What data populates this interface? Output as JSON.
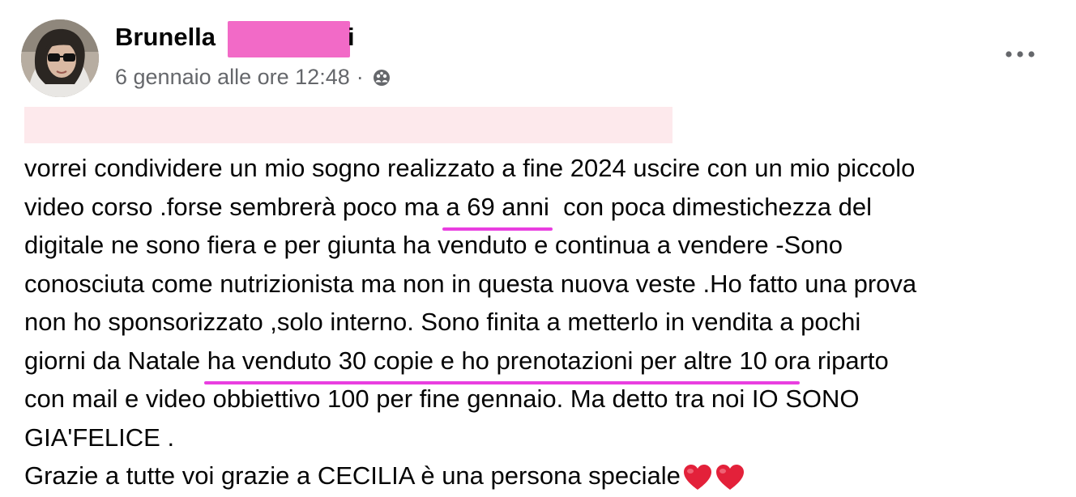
{
  "post": {
    "author_name": "Brunella",
    "author_name_tail": "i",
    "timestamp": "6 gennaio alle ore 12:48",
    "separator": "·",
    "privacy_icon": "group-icon",
    "menu_icon": "more-horizontal-icon",
    "body_lines": [
      {
        "segments": [
          "vorrei condividere un mio sogno realizzato a fine 2024 uscire con un mio piccolo"
        ]
      },
      {
        "before": "video corso .forse sembrerà poco ma ",
        "highlight": "a 69 anni",
        "after": "  con poca dimestichezza del"
      },
      {
        "segments": [
          "digitale ne sono fiera e per giunta ha venduto e continua a vendere -Sono"
        ]
      },
      {
        "segments": [
          "conosciuta come nutrizionista ma non in questa nuova veste .Ho fatto una prova"
        ]
      },
      {
        "segments": [
          "non ho sponsorizzato ,solo interno. Sono finita a metterlo in vendita a pochi"
        ]
      },
      {
        "before": "giorni da Natale ",
        "highlight": "ha venduto 30 copie e ho prenotazioni per altre 10 or",
        "after": "a riparto"
      },
      {
        "segments": [
          "con mail e video obbiettivo 100 per fine gennaio. Ma detto tra noi IO SONO"
        ]
      },
      {
        "segments": [
          "GIA'FELICE ."
        ]
      },
      {
        "before": "Grazie a tutte voi grazie a CECILIA è una persona speciale",
        "highlight": "",
        "after": ""
      }
    ],
    "emoji": [
      "heart-icon",
      "heart-icon"
    ],
    "colors": {
      "highlight_underline": "#e93ee0",
      "redaction_name": "#f26ac7",
      "redaction_line": "#fde9ec",
      "meta_text": "#65676b",
      "heart": "#e3213a"
    }
  }
}
